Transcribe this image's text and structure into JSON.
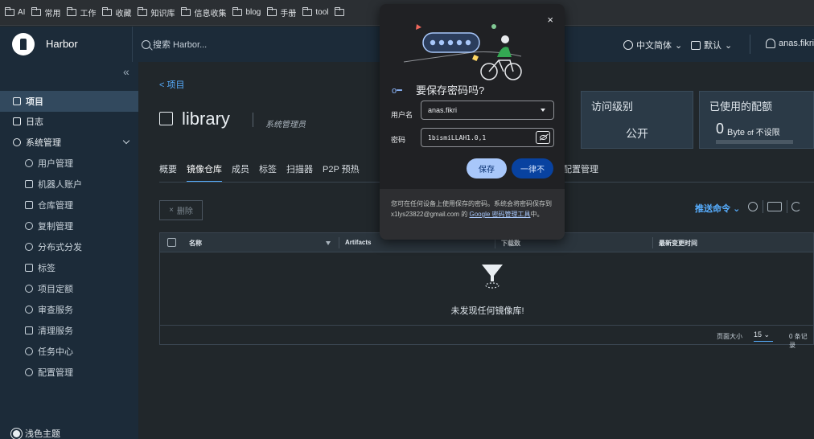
{
  "bookmarks": [
    "AI",
    "常用",
    "工作",
    "收藏",
    "知识库",
    "信息收集",
    "blog",
    "手册",
    "tool"
  ],
  "header": {
    "brand": "Harbor",
    "search_placeholder": "搜索 Harbor...",
    "language": "中文简体",
    "language_caret": "⌄",
    "theme_mode": "默认",
    "theme_caret": "⌄",
    "user": "anas.fikri"
  },
  "sidebar": {
    "collapse_glyph": "«",
    "items": [
      {
        "label": "项目",
        "active": true,
        "sub": false,
        "icon": "project-icon"
      },
      {
        "label": "日志",
        "active": false,
        "sub": false,
        "icon": "log-icon"
      },
      {
        "label": "系统管理",
        "active": false,
        "sub": false,
        "icon": "admin-icon"
      },
      {
        "label": "用户管理",
        "active": false,
        "sub": true,
        "icon": "users-icon"
      },
      {
        "label": "机器人账户",
        "active": false,
        "sub": true,
        "icon": "robot-icon"
      },
      {
        "label": "仓库管理",
        "active": false,
        "sub": true,
        "icon": "registry-icon"
      },
      {
        "label": "复制管理",
        "active": false,
        "sub": true,
        "icon": "replication-icon"
      },
      {
        "label": "分布式分发",
        "active": false,
        "sub": true,
        "icon": "distribution-icon"
      },
      {
        "label": "标签",
        "active": false,
        "sub": true,
        "icon": "tag-icon"
      },
      {
        "label": "项目定额",
        "active": false,
        "sub": true,
        "icon": "quota-icon"
      },
      {
        "label": "审查服务",
        "active": false,
        "sub": true,
        "icon": "shield-icon"
      },
      {
        "label": "清理服务",
        "active": false,
        "sub": true,
        "icon": "trash-icon"
      },
      {
        "label": "任务中心",
        "active": false,
        "sub": true,
        "icon": "task-icon"
      },
      {
        "label": "配置管理",
        "active": false,
        "sub": true,
        "icon": "gear-icon"
      }
    ],
    "theme_toggle": "浅色主题"
  },
  "main": {
    "breadcrumb": "< 项目",
    "project_name": "library",
    "role": "系统管理员",
    "access_card": {
      "label": "访问级别",
      "value": "公开"
    },
    "quota_card": {
      "label": "已使用的配额",
      "used": "0",
      "unit": "Byte",
      "of": "of",
      "limit": "不设限"
    },
    "tabs": [
      "概要",
      "镜像仓库",
      "成员",
      "标签",
      "扫描器",
      "P2P 预热"
    ],
    "tab_right": "配置管理",
    "delete_button": "删除",
    "delete_glyph": "×",
    "push_command": "推送命令",
    "push_caret": "⌄",
    "table": {
      "columns": [
        "名称",
        "Artifacts",
        "下载数",
        "最新变更时间"
      ],
      "empty_text": "未发现任何镜像库!",
      "page_size_label": "页面大小",
      "page_size": "15",
      "page_size_caret": "⌄",
      "count": "0 条记录"
    }
  },
  "password_popup": {
    "title": "要保存密码吗?",
    "close_glyph": "×",
    "username_label": "用户名",
    "username_value": "anas.fikri",
    "password_label": "密码",
    "password_value": "1bismiLLAH1.0,1",
    "save_button": "保存",
    "never_button": "一律不",
    "footer_pre": "您可在任何设备上使用保存的密码。系统会将密码保存到 x1lys23822@gmail.com 的 ",
    "footer_link": "Google 密码管理工具",
    "footer_post": "中。"
  },
  "colors": {
    "accent": "#57aeff",
    "header_bg": "#1c2b39",
    "content_bg": "#21272b",
    "popup_bg": "#202124",
    "save_btn": "#a8c7fa",
    "never_btn": "#0842a0"
  }
}
